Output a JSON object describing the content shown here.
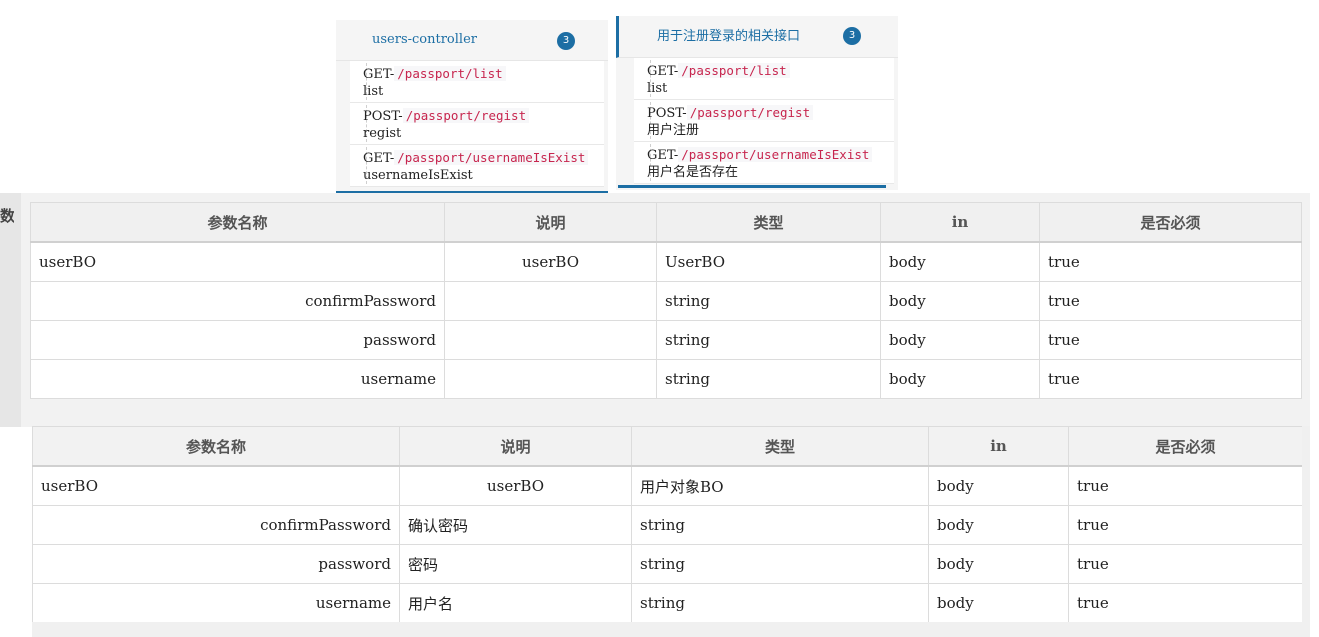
{
  "panels": [
    {
      "title": "users-controller",
      "count": "3",
      "ops": [
        {
          "method": "GET-",
          "path": "/passport/list",
          "summary": "list"
        },
        {
          "method": "POST-",
          "path": "/passport/regist",
          "summary": "regist"
        },
        {
          "method": "GET-",
          "path": "/passport/usernameIsExist",
          "summary": "usernameIsExist"
        }
      ]
    },
    {
      "title": "用于注册登录的相关接口",
      "count": "3",
      "ops": [
        {
          "method": "GET-",
          "path": "/passport/list",
          "summary": "list"
        },
        {
          "method": "POST-",
          "path": "/passport/regist",
          "summary": "用户注册"
        },
        {
          "method": "GET-",
          "path": "/passport/usernameIsExist",
          "summary": "用户名是否存在"
        }
      ]
    }
  ],
  "section1": {
    "side_label": "数",
    "headers": [
      "参数名称",
      "说明",
      "类型",
      "in",
      "是否必须"
    ],
    "rows": [
      {
        "name": "userBO",
        "desc": "userBO",
        "type": "UserBO",
        "in": "body",
        "required": "true"
      },
      {
        "name": "confirmPassword",
        "desc": "",
        "type": "string",
        "in": "body",
        "required": "true"
      },
      {
        "name": "password",
        "desc": "",
        "type": "string",
        "in": "body",
        "required": "true"
      },
      {
        "name": "username",
        "desc": "",
        "type": "string",
        "in": "body",
        "required": "true"
      }
    ]
  },
  "section2": {
    "headers": [
      "参数名称",
      "说明",
      "类型",
      "in",
      "是否必须"
    ],
    "rows": [
      {
        "name": "userBO",
        "desc": "userBO",
        "type": "用户对象BO",
        "in": "body",
        "required": "true"
      },
      {
        "name": "confirmPassword",
        "desc": "确认密码",
        "type": "string",
        "in": "body",
        "required": "true"
      },
      {
        "name": "password",
        "desc": "密码",
        "type": "string",
        "in": "body",
        "required": "true"
      },
      {
        "name": "username",
        "desc": "用户名",
        "type": "string",
        "in": "body",
        "required": "true"
      }
    ]
  },
  "colors": {
    "accent": "#1c6ea4",
    "code": "#c7254e"
  }
}
